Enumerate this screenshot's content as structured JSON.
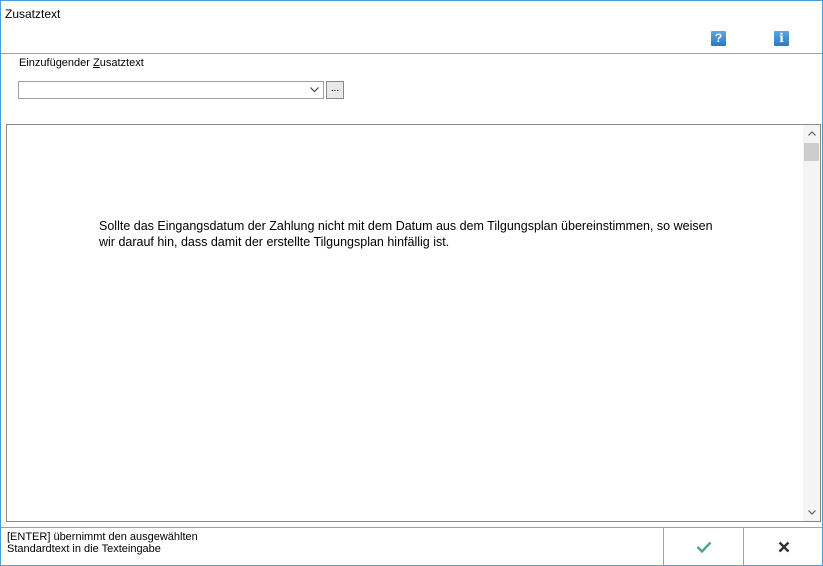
{
  "window": {
    "title": "Zusatztext"
  },
  "icons": {
    "help": "?",
    "info": "i"
  },
  "field": {
    "label_prefix": "Einzufügender ",
    "label_underlined": "Z",
    "label_suffix": "usatztext",
    "value": "",
    "browse_label": "..."
  },
  "text_area": {
    "lines": [
      "Sollte das Eingangsdatum der Zahlung nicht mit dem Datum aus dem Tilgungsplan übereinstimmen, so weisen",
      "wir darauf hin, dass damit der erstellte Tilgungsplan hinfällig ist."
    ]
  },
  "status": {
    "line1": "[ENTER] übernimmt den ausgewählten",
    "line2": "Standardtext in die Texteingabe"
  },
  "colors": {
    "ok_check": "#4aa88a",
    "cancel_x": "#333333",
    "accent": "#4a9bd8"
  }
}
